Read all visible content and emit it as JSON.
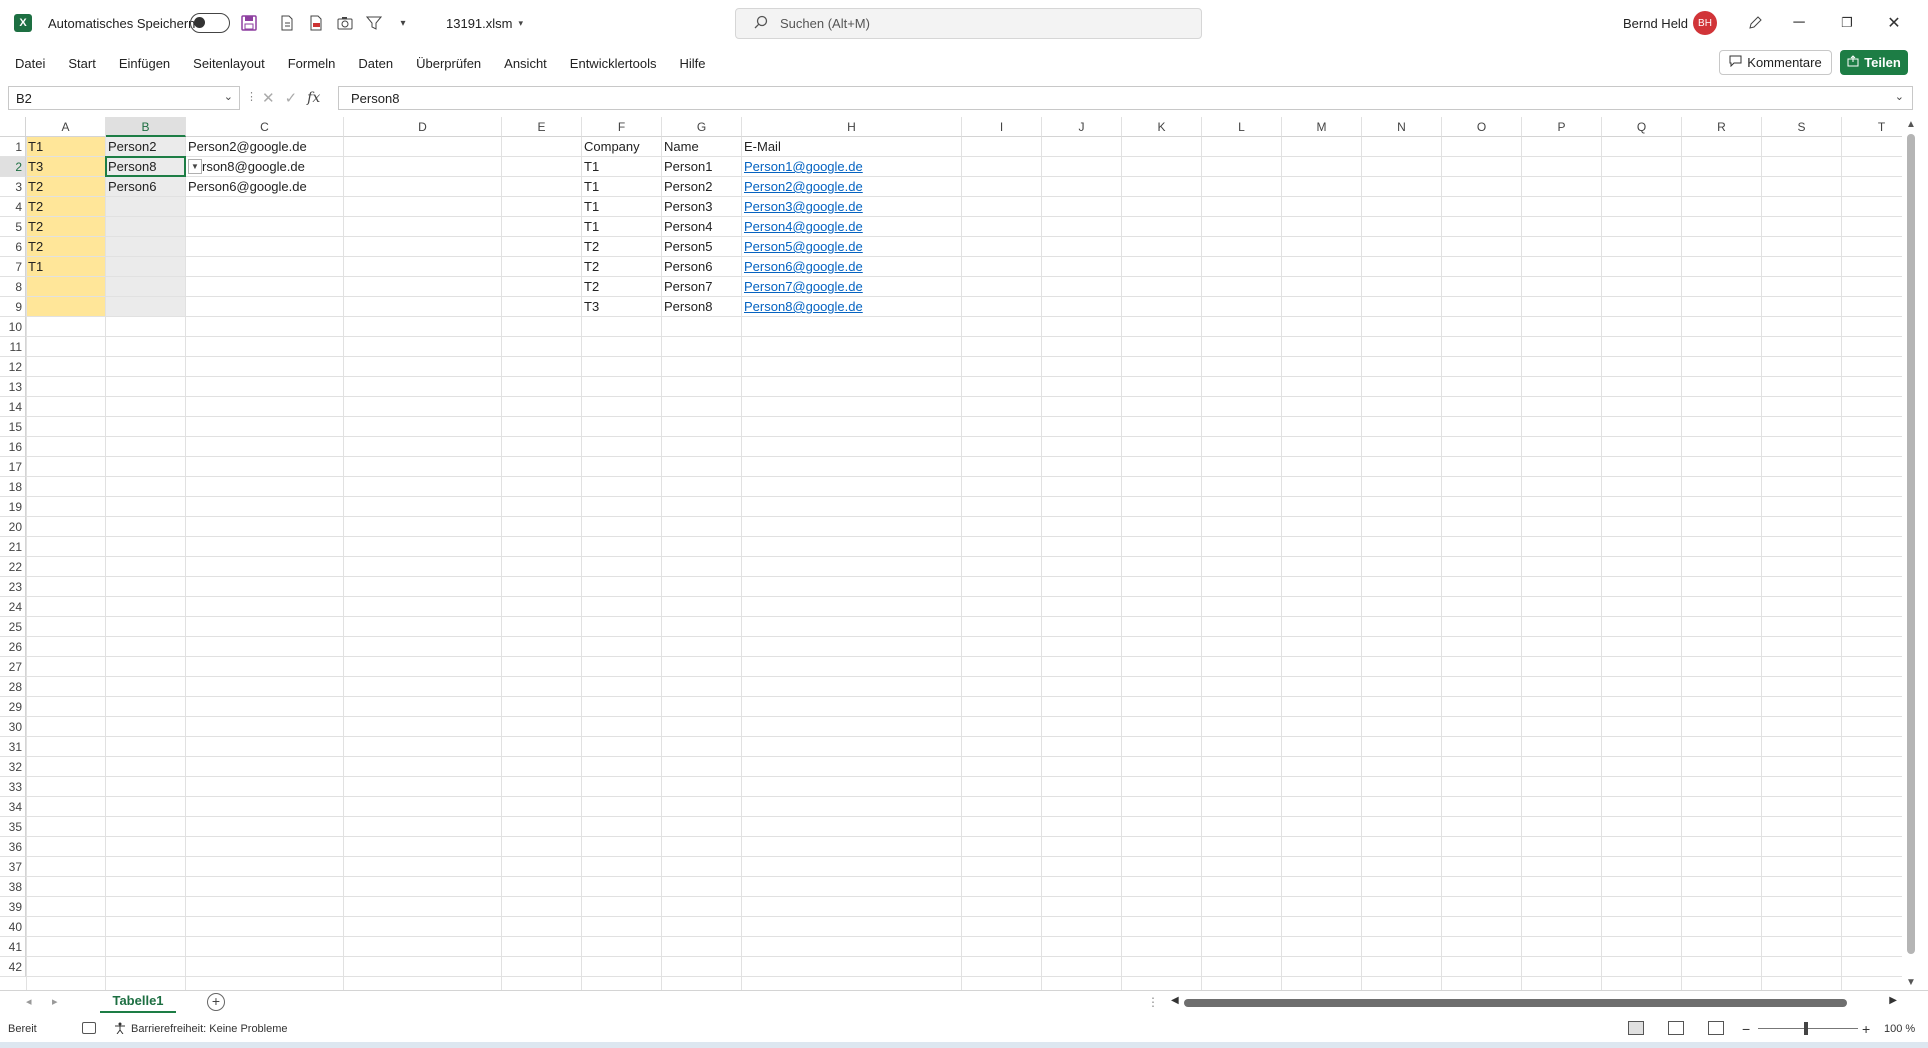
{
  "titlebar": {
    "autosave_label": "Automatisches Speichern",
    "filename": "13191.xlsm",
    "search_placeholder": "Suchen (Alt+M)",
    "user_name": "Bernd Held",
    "user_initials": "BH"
  },
  "menu": [
    "Datei",
    "Start",
    "Einfügen",
    "Seitenlayout",
    "Formeln",
    "Daten",
    "Überprüfen",
    "Ansicht",
    "Entwicklertools",
    "Hilfe"
  ],
  "actions": {
    "comments": "Kommentare",
    "share": "Teilen"
  },
  "formula_bar": {
    "name_box": "B2",
    "formula": "Person8"
  },
  "columns": [
    "A",
    "B",
    "C",
    "D",
    "E",
    "F",
    "G",
    "H",
    "I",
    "J",
    "K",
    "L",
    "M",
    "N",
    "O",
    "P",
    "Q",
    "R",
    "S",
    "T"
  ],
  "row_count": 42,
  "cells": {
    "A": [
      "T1",
      "T3",
      "T2",
      "T2",
      "T2",
      "T2",
      "T1"
    ],
    "B": [
      "Person2",
      "Person8",
      "Person6"
    ],
    "C": [
      "Person2@google.de",
      "rson8@google.de",
      "Person6@google.de"
    ],
    "F": [
      "Company",
      "T1",
      "T1",
      "T1",
      "T1",
      "T2",
      "T2",
      "T2",
      "T3"
    ],
    "G": [
      "Name",
      "Person1",
      "Person2",
      "Person3",
      "Person4",
      "Person5",
      "Person6",
      "Person7",
      "Person8"
    ],
    "H": [
      "E-Mail",
      "Person1@google.de",
      "Person2@google.de",
      "Person3@google.de",
      "Person4@google.de",
      "Person5@google.de",
      "Person6@google.de",
      "Person7@google.de",
      "Person8@google.de"
    ]
  },
  "selection": {
    "cell": "B2",
    "column": "B",
    "row": 2
  },
  "sheets": [
    "Tabelle1"
  ],
  "status": {
    "ready": "Bereit",
    "accessibility": "Barrierefreiheit: Keine Probleme",
    "zoom": "100 %"
  },
  "colors": {
    "accent": "#1d7d45",
    "fill_a": "#ffe699",
    "fill_b": "#ebebeb",
    "link": "#0563c1"
  }
}
